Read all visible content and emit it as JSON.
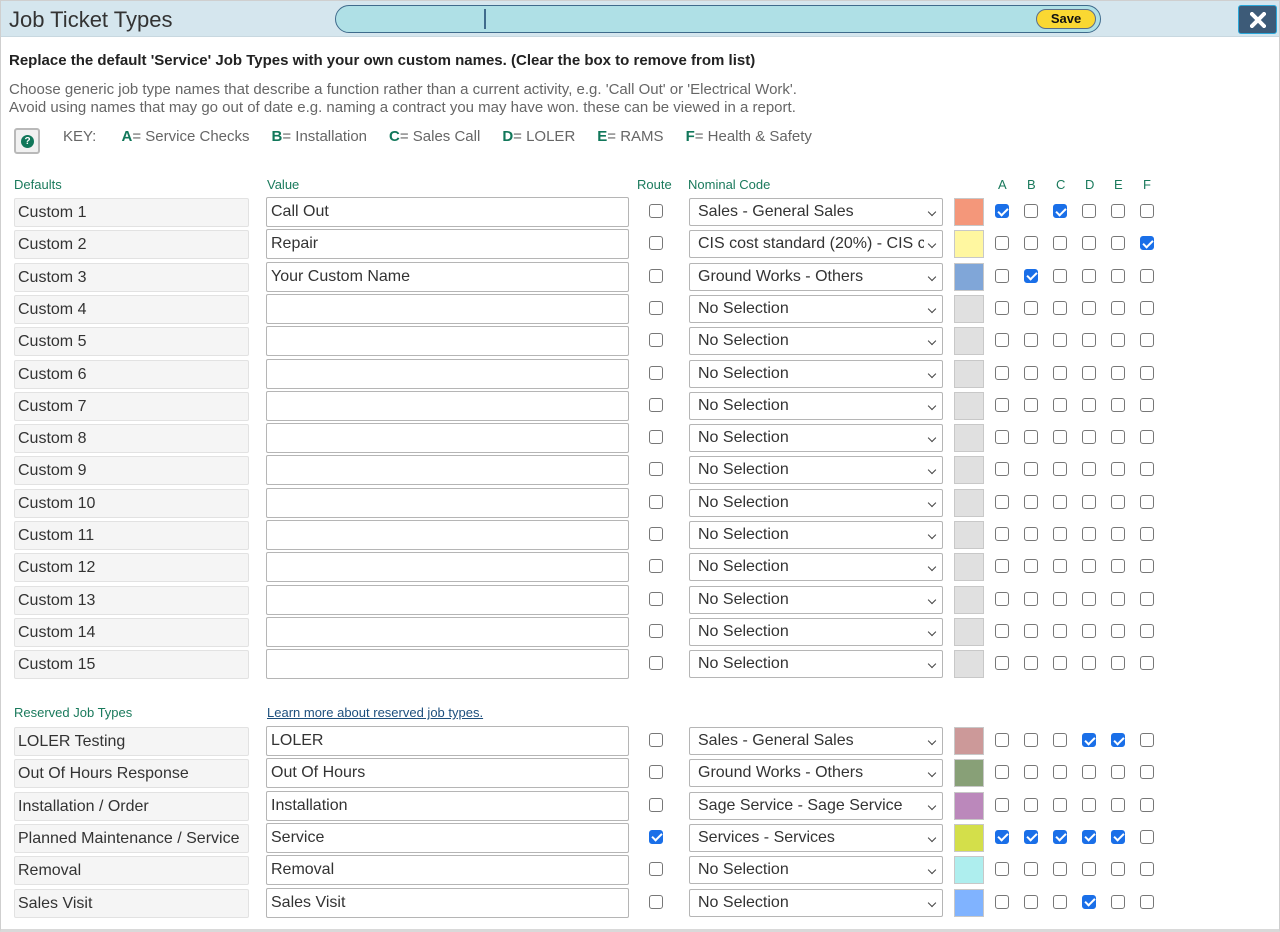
{
  "header": {
    "title": "Job Ticket Types",
    "save_label": "Save",
    "close_icon": "close-x-icon"
  },
  "intro": {
    "bold": "Replace the default 'Service' Job Types with your own custom names. (Clear the box to remove from list)",
    "line1": "Choose generic job type names that describe a function rather than a current activity, e.g. 'Call Out' or 'Electrical Work'.",
    "line2": "Avoid using names that may go out of date e.g. naming a contract you may have won. these can be viewed in a report."
  },
  "key": {
    "help_icon": "question-circle-icon",
    "label": "KEY:",
    "items": [
      {
        "letter": "A",
        "text": "= Service Checks"
      },
      {
        "letter": "B",
        "text": "= Installation"
      },
      {
        "letter": "C",
        "text": "= Sales Call"
      },
      {
        "letter": "D",
        "text": "= LOLER"
      },
      {
        "letter": "E",
        "text": "= RAMS"
      },
      {
        "letter": "F",
        "text": "= Health & Safety"
      }
    ]
  },
  "columns": {
    "defaults": "Defaults",
    "value": "Value",
    "route": "Route",
    "nominal": "Nominal Code",
    "flags": [
      "A",
      "B",
      "C",
      "D",
      "E",
      "F"
    ]
  },
  "custom_rows": [
    {
      "default": "Custom 1",
      "value": "Call Out",
      "route": false,
      "nominal": "Sales - General Sales",
      "color": "#f4977a",
      "flags": [
        true,
        false,
        true,
        false,
        false,
        false
      ]
    },
    {
      "default": "Custom 2",
      "value": "Repair",
      "route": false,
      "nominal": "CIS cost standard (20%) - CIS c",
      "color": "#fff7a0",
      "flags": [
        false,
        false,
        false,
        false,
        false,
        true
      ]
    },
    {
      "default": "Custom 3",
      "value": "Your Custom Name",
      "route": false,
      "nominal": "Ground Works - Others",
      "color": "#80a6d8",
      "flags": [
        false,
        true,
        false,
        false,
        false,
        false
      ]
    },
    {
      "default": "Custom 4",
      "value": "",
      "route": false,
      "nominal": "No Selection",
      "color": "#e0e0e0",
      "flags": [
        false,
        false,
        false,
        false,
        false,
        false
      ]
    },
    {
      "default": "Custom 5",
      "value": "",
      "route": false,
      "nominal": "No Selection",
      "color": "#e0e0e0",
      "flags": [
        false,
        false,
        false,
        false,
        false,
        false
      ]
    },
    {
      "default": "Custom 6",
      "value": "",
      "route": false,
      "nominal": "No Selection",
      "color": "#e0e0e0",
      "flags": [
        false,
        false,
        false,
        false,
        false,
        false
      ]
    },
    {
      "default": "Custom 7",
      "value": "",
      "route": false,
      "nominal": "No Selection",
      "color": "#e0e0e0",
      "flags": [
        false,
        false,
        false,
        false,
        false,
        false
      ]
    },
    {
      "default": "Custom 8",
      "value": "",
      "route": false,
      "nominal": "No Selection",
      "color": "#e0e0e0",
      "flags": [
        false,
        false,
        false,
        false,
        false,
        false
      ]
    },
    {
      "default": "Custom 9",
      "value": "",
      "route": false,
      "nominal": "No Selection",
      "color": "#e0e0e0",
      "flags": [
        false,
        false,
        false,
        false,
        false,
        false
      ]
    },
    {
      "default": "Custom 10",
      "value": "",
      "route": false,
      "nominal": "No Selection",
      "color": "#e0e0e0",
      "flags": [
        false,
        false,
        false,
        false,
        false,
        false
      ]
    },
    {
      "default": "Custom 11",
      "value": "",
      "route": false,
      "nominal": "No Selection",
      "color": "#e0e0e0",
      "flags": [
        false,
        false,
        false,
        false,
        false,
        false
      ]
    },
    {
      "default": "Custom 12",
      "value": "",
      "route": false,
      "nominal": "No Selection",
      "color": "#e0e0e0",
      "flags": [
        false,
        false,
        false,
        false,
        false,
        false
      ]
    },
    {
      "default": "Custom 13",
      "value": "",
      "route": false,
      "nominal": "No Selection",
      "color": "#e0e0e0",
      "flags": [
        false,
        false,
        false,
        false,
        false,
        false
      ]
    },
    {
      "default": "Custom 14",
      "value": "",
      "route": false,
      "nominal": "No Selection",
      "color": "#e0e0e0",
      "flags": [
        false,
        false,
        false,
        false,
        false,
        false
      ]
    },
    {
      "default": "Custom 15",
      "value": "",
      "route": false,
      "nominal": "No Selection",
      "color": "#e0e0e0",
      "flags": [
        false,
        false,
        false,
        false,
        false,
        false
      ]
    }
  ],
  "reserved": {
    "heading": "Reserved Job Types",
    "learn_more": "Learn more about reserved job types.",
    "rows": [
      {
        "default": "LOLER Testing",
        "value": "LOLER",
        "route": false,
        "nominal": "Sales - General Sales",
        "color": "#cc9999",
        "flags": [
          false,
          false,
          false,
          true,
          true,
          false
        ]
      },
      {
        "default": "Out Of Hours Response",
        "value": "Out Of Hours",
        "route": false,
        "nominal": "Ground Works - Others",
        "color": "#88a077",
        "flags": [
          false,
          false,
          false,
          false,
          false,
          false
        ]
      },
      {
        "default": "Installation / Order",
        "value": "Installation",
        "route": false,
        "nominal": "Sage Service - Sage Service",
        "color": "#bb88bb",
        "flags": [
          false,
          false,
          false,
          false,
          false,
          false
        ]
      },
      {
        "default": "Planned Maintenance / Service",
        "value": "Service",
        "route": true,
        "nominal": "Services - Services",
        "color": "#d4df4a",
        "flags": [
          true,
          true,
          true,
          true,
          true,
          false
        ]
      },
      {
        "default": "Removal",
        "value": "Removal",
        "route": false,
        "nominal": "No Selection",
        "color": "#aeeeee",
        "flags": [
          false,
          false,
          false,
          false,
          false,
          false
        ]
      },
      {
        "default": "Sales Visit",
        "value": "Sales Visit",
        "route": false,
        "nominal": "No Selection",
        "color": "#80b3ff",
        "flags": [
          false,
          false,
          false,
          true,
          false,
          false
        ]
      }
    ]
  }
}
